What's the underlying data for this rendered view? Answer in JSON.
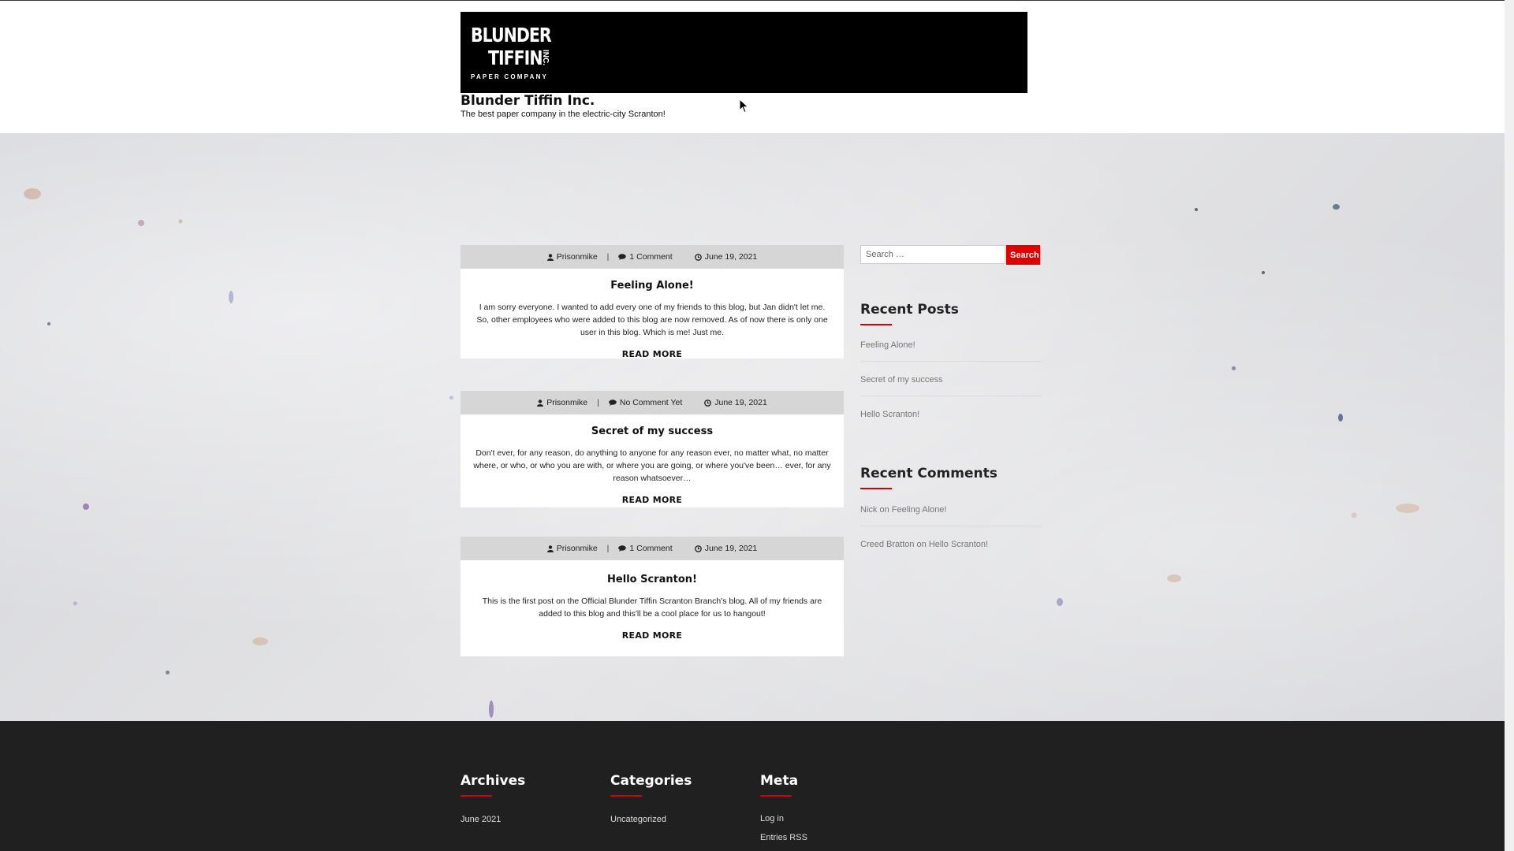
{
  "header": {
    "logo": {
      "line1": "BLUNDER",
      "line2": "TIFFIN",
      "inc": "INC.",
      "line3": "PAPER COMPANY"
    },
    "site_title": "Blunder Tiffin Inc.",
    "tagline": "The best paper company in the electric-city Scranton!"
  },
  "posts": [
    {
      "author": "Prisonmike",
      "comments": "1 Comment",
      "date": "June 19, 2021",
      "title": "Feeling Alone!",
      "excerpt": "I am sorry everyone. I wanted to add every one of my friends to this blog, but Jan didn't let me. So, other employees who were added to this blog are now removed. As of now there is only one user in this blog. Which is me! Just me.",
      "read_more": "READ MORE"
    },
    {
      "author": "Prisonmike",
      "comments": "No Comment Yet",
      "date": "June 19, 2021",
      "title": "Secret of my success",
      "excerpt": "Don't ever, for any reason, do anything to anyone for any reason ever, no matter what, no matter where, or who, or who you are with, or where you are going, or where you've been… ever, for any reason whatsoever…",
      "read_more": "READ MORE"
    },
    {
      "author": "Prisonmike",
      "comments": "1 Comment",
      "date": "June 19, 2021",
      "title": "Hello Scranton!",
      "excerpt": "This is the first post on the Official Blunder Tiffin Scranton Branch's blog. All of my friends are added to this blog and this'll be a cool place for us to hangout!",
      "read_more": "READ MORE"
    }
  ],
  "sidebar": {
    "search": {
      "placeholder": "Search …",
      "button": "Search"
    },
    "recent_posts": {
      "title": "Recent Posts",
      "items": [
        "Feeling Alone!",
        "Secret of my success",
        "Hello Scranton!"
      ]
    },
    "recent_comments": {
      "title": "Recent Comments",
      "items": [
        {
          "author": "Nick",
          "on": "on",
          "post": "Feeling Alone!"
        },
        {
          "author": "Creed Bratton",
          "on": "on",
          "post": "Hello Scranton!"
        }
      ]
    }
  },
  "footer": {
    "archives": {
      "title": "Archives",
      "items": [
        "June 2021"
      ]
    },
    "categories": {
      "title": "Categories",
      "items": [
        "Uncategorized"
      ]
    },
    "meta": {
      "title": "Meta",
      "items": [
        "Log in",
        "Entries RSS"
      ]
    }
  },
  "colors": {
    "accent": "#d40000",
    "search_button": "#e00000",
    "footer_bg": "#202020",
    "meta_bar": "#d6d6d6"
  },
  "icons": [
    "user-icon",
    "comment-icon",
    "clock-icon",
    "mouse-cursor-icon"
  ]
}
